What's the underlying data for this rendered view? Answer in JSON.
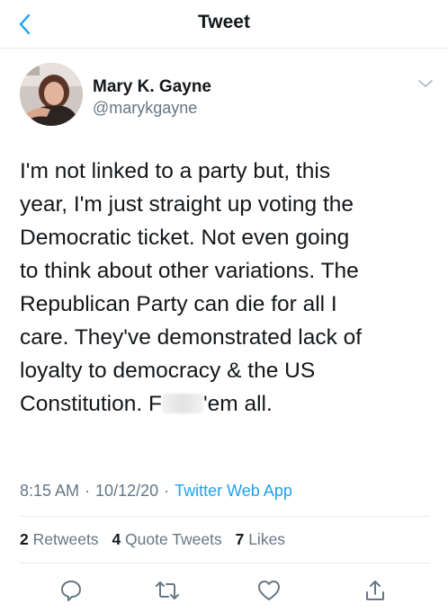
{
  "header": {
    "title": "Tweet",
    "back_icon": "chevron-left-icon"
  },
  "author": {
    "name": "Mary K. Gayne",
    "handle": "@marykgayne",
    "menu_icon": "chevron-down-icon"
  },
  "tweet": {
    "text_part1": "I'm not linked to a party but, this\nyear, I'm just straight up voting the\nDemocratic ticket. Not even going\nto think about other variations. The\nRepublican Party can die for all I\ncare. They've demonstrated lack of\nloyalty to democracy & the US\nConstitution. F",
    "text_part2": "'em all."
  },
  "meta": {
    "time": "8:15 AM",
    "date": "10/12/20",
    "source": "Twitter Web App"
  },
  "stats": {
    "retweets_count": "2",
    "retweets_label": "Retweets",
    "quotes_count": "4",
    "quotes_label": "Quote Tweets",
    "likes_count": "7",
    "likes_label": "Likes"
  },
  "actions": {
    "reply_icon": "reply-icon",
    "retweet_icon": "retweet-icon",
    "like_icon": "heart-icon",
    "share_icon": "share-icon"
  },
  "colors": {
    "accent": "#1da1f2",
    "text": "#14171a",
    "secondary": "#657786",
    "divider": "#e6ecf0"
  }
}
